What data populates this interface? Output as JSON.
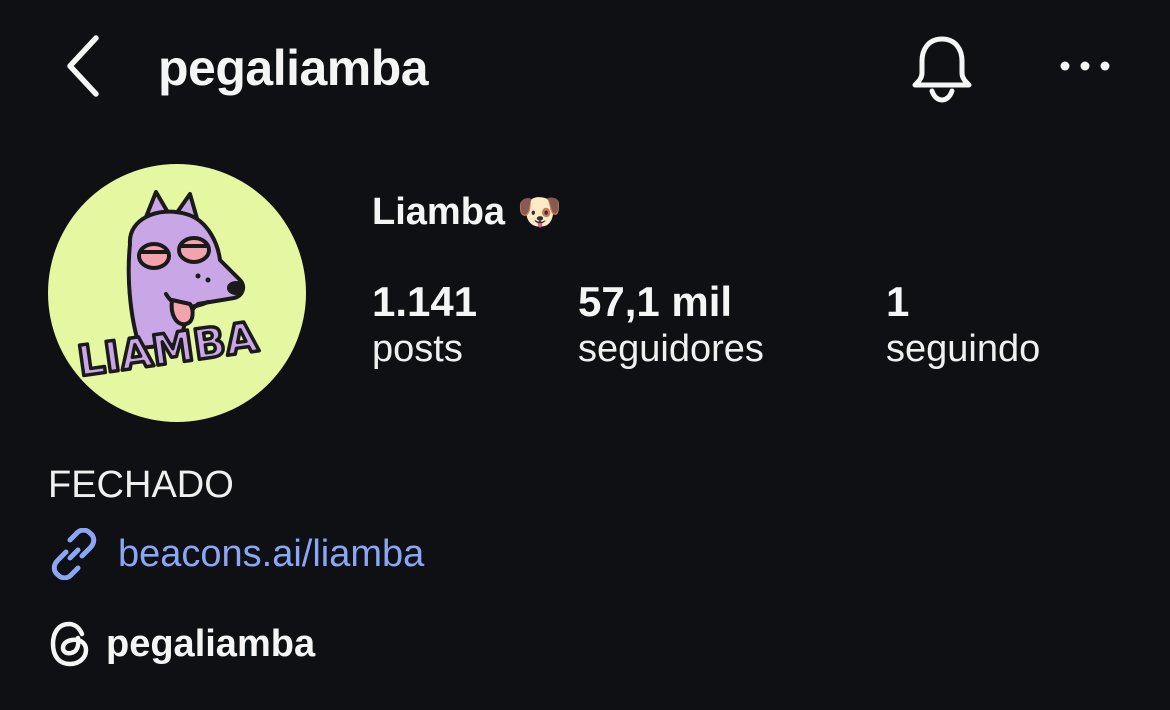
{
  "header": {
    "back_icon": "chevron-left-icon",
    "username": "pegaliamba",
    "bell_icon": "bell-icon",
    "more_icon": "more-horizontal-icon"
  },
  "profile": {
    "avatar_text": "LIAMBA",
    "display_name": "Liamba",
    "name_emoji": "🐶",
    "stats": [
      {
        "value": "1.141",
        "label": "posts"
      },
      {
        "value": "57,1 mil",
        "label": "seguidores"
      },
      {
        "value": "1",
        "label": "seguindo"
      }
    ]
  },
  "bio": {
    "text": "FECHADO",
    "link_icon": "link-icon",
    "link_text": "beacons.ai/liamba",
    "threads_icon": "threads-icon",
    "threads_handle": "pegaliamba"
  },
  "colors": {
    "background": "#0e1013",
    "text": "#f5f5f5",
    "link": "#8aa6f5",
    "avatar_bg": "#e6f7a2",
    "avatar_character": "#c9a6e6"
  }
}
